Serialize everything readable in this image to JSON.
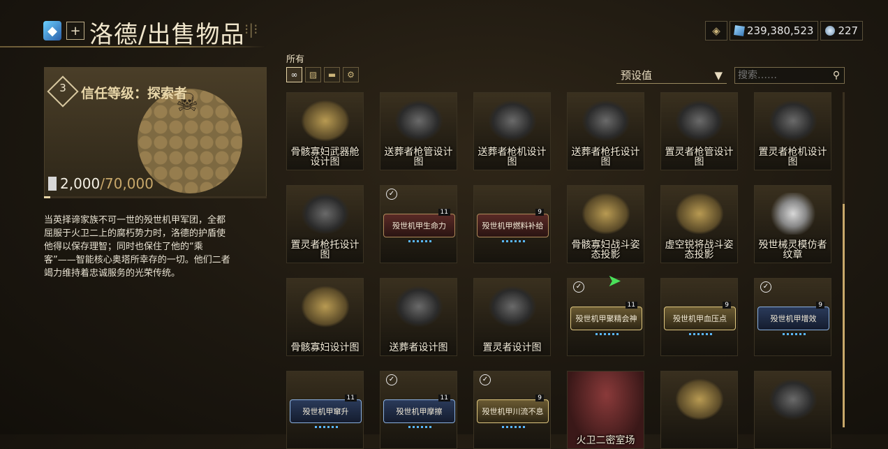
{
  "header": {
    "title": "洛德/出售物品",
    "plus_label": "+",
    "ornament": "⁝|⁝"
  },
  "currency": {
    "platinum": "239,380,523",
    "aya": "227"
  },
  "trust": {
    "rank": "3",
    "title": "信任等级：探索者",
    "standing_current": "2,000",
    "standing_max": "/70,000",
    "standing_progress": 0.0286
  },
  "description": "当英择谛家族不可一世的殁世机甲军团，全都屈服于火卫二上的腐朽势力时，洛德的护盾使他得以保存理智；同时也保住了他的“乘客”——智能核心奥塔所幸存的一切。他们二者竭力维持着忠诚服务的光荣传统。",
  "filters": {
    "label": "所有",
    "items": [
      {
        "icon": "infinity-icon",
        "glyph": "∞"
      },
      {
        "icon": "weapon-icon",
        "glyph": "▨"
      },
      {
        "icon": "module-icon",
        "glyph": "▬"
      },
      {
        "icon": "gear-icon",
        "glyph": "⚙"
      }
    ]
  },
  "sort": {
    "value": "预设值",
    "arrow": "▼"
  },
  "search": {
    "placeholder": "搜索……"
  },
  "colors": {
    "accent": "#c8a86a",
    "text": "#e8dcc0",
    "mod_blue": "#8ab0e0"
  },
  "items": [
    {
      "name": "骨骸寡妇武器舱设计图",
      "kind": "art",
      "art": "gold"
    },
    {
      "name": "送葬者枪管设计图",
      "kind": "art",
      "art": "dark"
    },
    {
      "name": "送葬者枪机设计图",
      "kind": "art",
      "art": "dark"
    },
    {
      "name": "送葬者枪托设计图",
      "kind": "art",
      "art": "dark"
    },
    {
      "name": "置灵者枪管设计图",
      "kind": "art",
      "art": "dark"
    },
    {
      "name": "置灵者枪机设计图",
      "kind": "art",
      "art": "dark"
    },
    {
      "name": "置灵者枪托设计图",
      "kind": "art",
      "art": "dark"
    },
    {
      "name": "殁世机甲生命力",
      "kind": "mod",
      "style": "red",
      "rank": "11",
      "owned": true
    },
    {
      "name": "殁世机甲燃料补给",
      "kind": "mod",
      "style": "red",
      "rank": "9",
      "owned": false
    },
    {
      "name": "骨骸寡妇战斗姿态投影",
      "kind": "art",
      "art": "gold"
    },
    {
      "name": "虚空锐将战斗姿态投影",
      "kind": "art",
      "art": "gold"
    },
    {
      "name": "殁世械灵模仿者纹章",
      "kind": "art",
      "art": "skull"
    },
    {
      "name": "骨骸寡妇设计图",
      "kind": "art",
      "art": "gold"
    },
    {
      "name": "送葬者设计图",
      "kind": "art",
      "art": "dark"
    },
    {
      "name": "置灵者设计图",
      "kind": "art",
      "art": "dark"
    },
    {
      "name": "殁世机甲聚精会神",
      "kind": "mod",
      "style": "gold",
      "rank": "11",
      "owned": true
    },
    {
      "name": "殁世机甲血压点",
      "kind": "mod",
      "style": "gold",
      "rank": "9",
      "owned": false
    },
    {
      "name": "殁世机甲增效",
      "kind": "mod",
      "style": "blue",
      "rank": "9",
      "owned": true
    },
    {
      "name": "殁世机甲窜升",
      "kind": "mod",
      "style": "blue",
      "rank": "11",
      "owned": false
    },
    {
      "name": "殁世机甲摩擦",
      "kind": "mod",
      "style": "blue",
      "rank": "11",
      "owned": true
    },
    {
      "name": "殁世机甲川流不息",
      "kind": "mod",
      "style": "gold",
      "rank": "9",
      "owned": true
    },
    {
      "name": "火卫二密室场",
      "kind": "art",
      "art": "red"
    },
    {
      "name": "",
      "kind": "art",
      "art": "gold"
    },
    {
      "name": "",
      "kind": "art",
      "art": "dark"
    }
  ]
}
